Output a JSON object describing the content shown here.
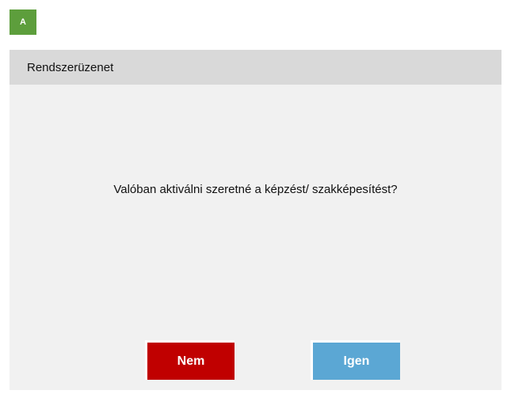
{
  "badge": {
    "label": "A",
    "color": "#5d9e3c"
  },
  "dialog": {
    "title": "Rendszerüzenet",
    "message": "Valóban aktiválni szeretné a képzést/ szakképesítést?",
    "buttons": {
      "no_label": "Nem",
      "yes_label": "Igen"
    }
  },
  "colors": {
    "header_bg": "#d9d9d9",
    "body_bg": "#f1f1f1",
    "no_button": "#c00000",
    "yes_button": "#5ba7d4"
  }
}
